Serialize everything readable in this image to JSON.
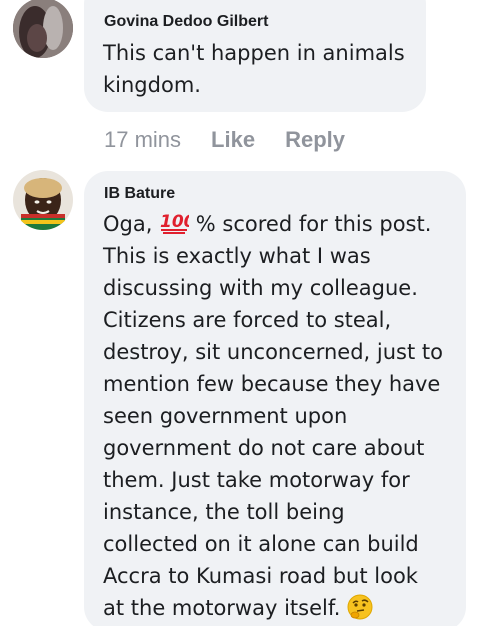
{
  "comments": [
    {
      "author": "Govina Dedoo Gilbert",
      "lines": [
        "This can't happen in animals",
        "kingdom."
      ],
      "time": "17 mins",
      "like_label": "Like",
      "reply_label": "Reply"
    },
    {
      "author": "IB Bature",
      "line1_before_emoji": "Oga, ",
      "line1_after_emoji": " % scored for this post.",
      "lines": [
        "This is exactly what I was",
        "discussing with my colleague.",
        "Citizens are forced to steal,",
        "destroy, sit unconcerned, just to",
        "mention few because they have",
        "seen government upon",
        "government do not care about",
        "them. Just take motorway for",
        "instance, the toll being",
        "collected on it alone can build",
        "Accra to Kumasi road but look"
      ],
      "last_line": "at the motorway itself. "
    }
  ],
  "icons": {
    "hundred_points": "hundred-points-emoji",
    "thinking_face": "thinking-face-emoji"
  },
  "colors": {
    "bubble": "#f0f2f5",
    "text": "#1c1e21",
    "meta": "#90949c",
    "emoji_red": "#e0202e",
    "emoji_yellow": "#f7c21f"
  }
}
